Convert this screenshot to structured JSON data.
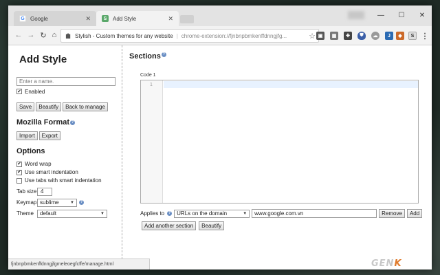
{
  "browser": {
    "tabs": [
      {
        "label": "Google",
        "active": false
      },
      {
        "label": "Add Style",
        "active": true
      }
    ],
    "omnibox": {
      "site_label": "Stylish - Custom themes for any website",
      "url": "chrome-extension://fjnbnpbmkenffdnngjfg..."
    },
    "status_url": "fjnbnpbmkenffdnngjfgmeleoegfcffe/manage.html"
  },
  "sidebar": {
    "title": "Add Style",
    "name_placeholder": "Enter a name.",
    "enabled_label": "Enabled",
    "enabled_checked": true,
    "buttons": {
      "save": "Save",
      "beautify": "Beautify",
      "back": "Back to manage"
    },
    "mozilla_format": {
      "heading": "Mozilla Format",
      "import": "Import",
      "export": "Export"
    },
    "options": {
      "heading": "Options",
      "word_wrap": {
        "label": "Word wrap",
        "checked": true
      },
      "smart_indent": {
        "label": "Use smart indentation",
        "checked": true
      },
      "tabs_smart_indent": {
        "label": "Use tabs with smart indentation",
        "checked": false
      },
      "tab_size": {
        "label": "Tab size",
        "value": "4"
      },
      "keymap": {
        "label": "Keymap",
        "value": "sublime"
      },
      "theme": {
        "label": "Theme",
        "value": "default"
      }
    }
  },
  "main": {
    "heading": "Sections",
    "code_label": "Code 1",
    "line_number": "1",
    "applies_to_label": "Applies to",
    "applies_type": "URLs on the domain",
    "applies_value": "www.google.com.vn",
    "remove": "Remove",
    "add": "Add",
    "add_section": "Add another section",
    "beautify": "Beautify"
  },
  "watermark": {
    "text": "GEN",
    "accent": "K"
  },
  "colors": {
    "help_icon": "#6b8fc4",
    "active_line": "#e8f2ff",
    "watermark_accent": "#e07a2a"
  }
}
